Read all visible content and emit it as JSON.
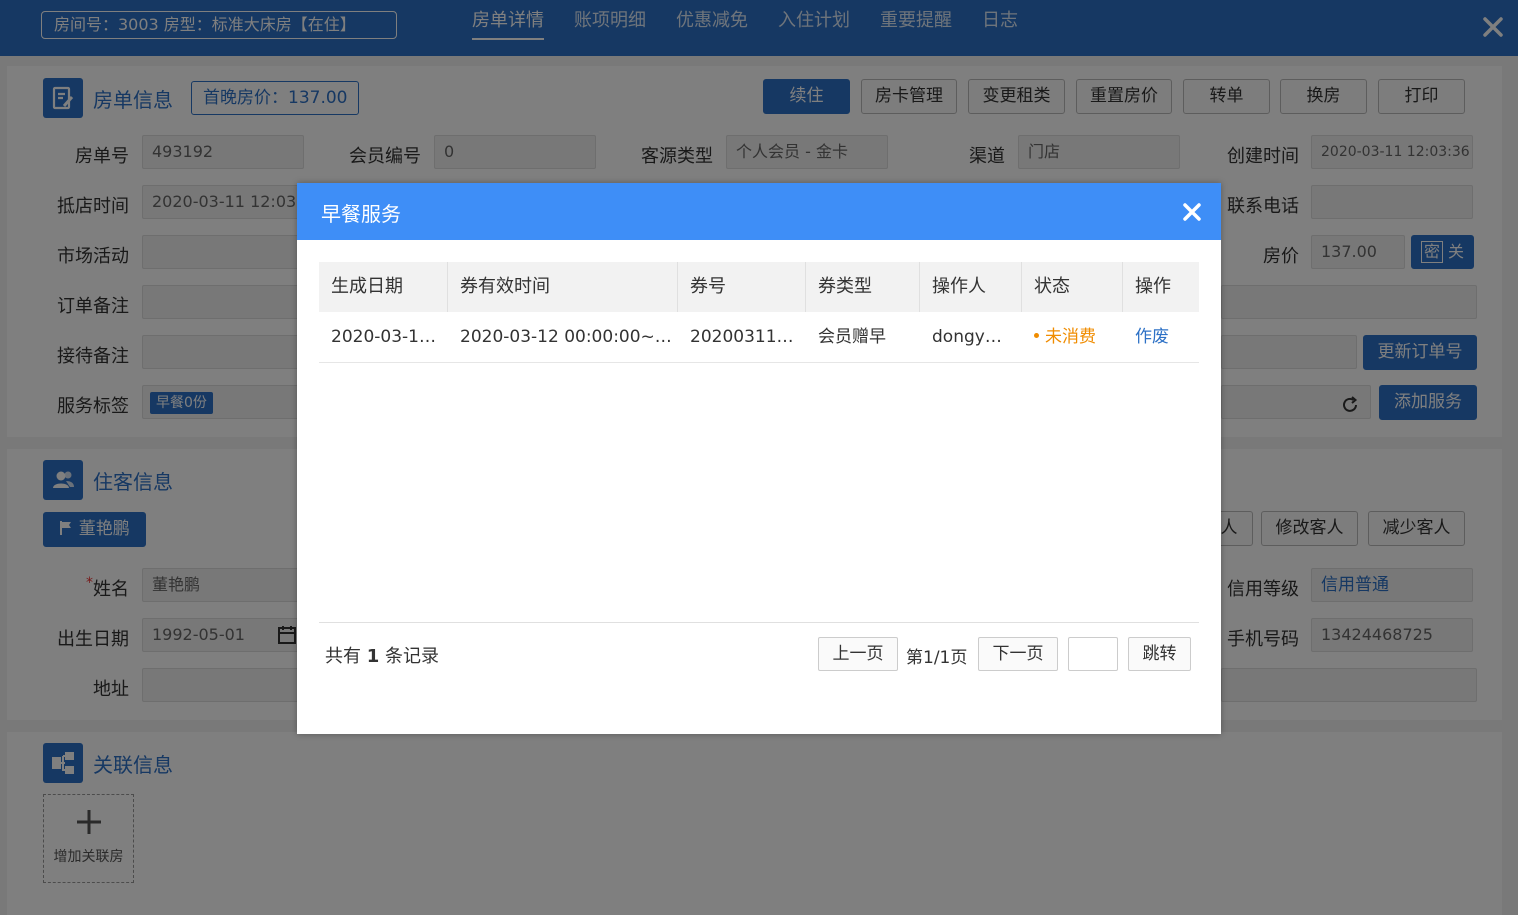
{
  "header": {
    "room_badge": "房间号：3003 房型：标准大床房【在住】",
    "tabs": [
      {
        "label": "房单详情",
        "active": true
      },
      {
        "label": "账项明细"
      },
      {
        "label": "优惠减免"
      },
      {
        "label": "入住计划"
      },
      {
        "label": "重要提醒"
      },
      {
        "label": "日志"
      }
    ]
  },
  "order": {
    "title": "房单信息",
    "first_night_price": "首晚房价：137.00",
    "buttons": [
      "续住",
      "房卡管理",
      "变更租类",
      "重置房价",
      "转单",
      "换房",
      "打印"
    ],
    "fields": {
      "order_no_label": "房单号",
      "order_no": "493192",
      "member_no_label": "会员编号",
      "member_no": "0",
      "source_label": "客源类型",
      "source": "个人会员 - 金卡",
      "channel_label": "渠道",
      "channel": "门店",
      "created_label": "创建时间",
      "created": "2020-03-11 12:03:36",
      "arrive_label": "抵店时间",
      "arrive": "2020-03-11 12:03",
      "phone_label": "联系电话",
      "phone": "",
      "market_label": "市场活动",
      "price_label": "房价",
      "price": "137.00",
      "price_secret": "密",
      "price_off": "关",
      "order_remark_label": "订单备注",
      "reception_remark_label": "接待备注",
      "update_order_button": "更新订单号",
      "service_tag_label": "服务标签",
      "service_tag": "早餐0份",
      "add_service_button": "添加服务"
    }
  },
  "guest": {
    "title": "住客信息",
    "guest_tab": "董艳鹏",
    "add_guest_partial": "人",
    "modify_guest_button": "修改客人",
    "remove_guest_button": "减少客人",
    "name_required": "*",
    "name_label": "姓名",
    "name": "董艳鹏",
    "birth_label": "出生日期",
    "birth": "1992-05-01",
    "address_label": "地址",
    "credit_label": "信用等级",
    "credit": "信用普通",
    "mobile_label": "手机号码",
    "mobile": "13424468725"
  },
  "related": {
    "title": "关联信息",
    "add_label": "增加关联房"
  },
  "modal": {
    "title": "早餐服务",
    "columns": [
      "生成日期",
      "券有效时间",
      "券号",
      "券类型",
      "操作人",
      "状态",
      "操作"
    ],
    "rows": [
      {
        "created": "2020-03-1…",
        "valid": "2020-03-12 00:00:00~…",
        "coupon_no": "20200311…",
        "coupon_type": "会员赠早",
        "operator": "dongy…",
        "status": "未消费",
        "action": "作废"
      }
    ],
    "total_prefix": "共有",
    "total_count": "1",
    "total_suffix": "条记录",
    "prev": "上一页",
    "page_info": "第1/1页",
    "next": "下一页",
    "jump": "跳转"
  },
  "colors": {
    "brand": "#2d71c6",
    "modal_header": "#3e8ef7",
    "status_pending": "#f08c00"
  }
}
